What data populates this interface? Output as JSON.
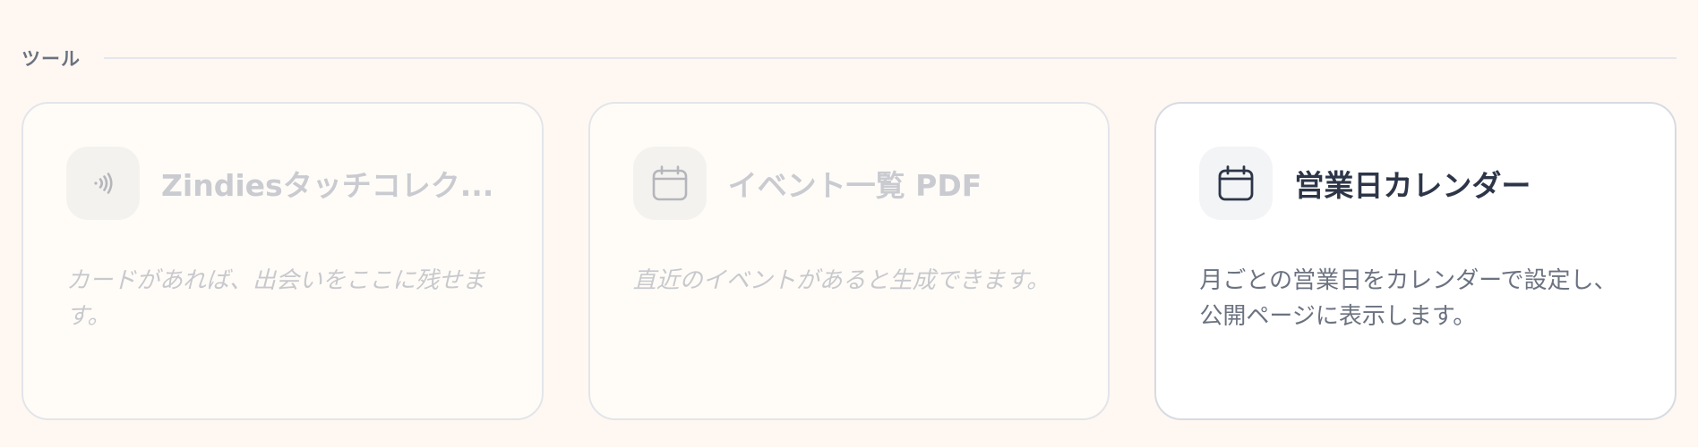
{
  "section": {
    "title": "ツール"
  },
  "cards": [
    {
      "title": "Zindiesタッチコレク...",
      "description": "カードがあれば、出会いをここに残せます。",
      "icon": "nfc-icon",
      "state": "disabled"
    },
    {
      "title": "イベント一覧 PDF",
      "description": "直近のイベントがあると生成できます。",
      "icon": "calendar-icon",
      "state": "disabled"
    },
    {
      "title": "営業日カレンダー",
      "description": "月ごとの営業日をカレンダーで設定し、公開ページに表示します。",
      "icon": "calendar-icon",
      "state": "enabled"
    }
  ],
  "colors": {
    "background": "#fff8f2",
    "disabled_text": "#c9cbd0",
    "enabled_title": "#2d3648",
    "enabled_desc": "#6b7280"
  }
}
